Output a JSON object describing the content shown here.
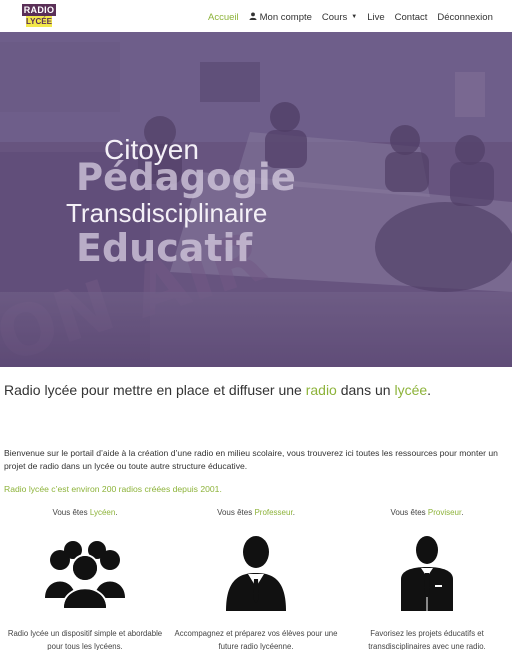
{
  "logo": {
    "line1": "RADIO",
    "line2": "LYCÉE"
  },
  "nav": {
    "items": [
      {
        "label": "Accueil",
        "active": true
      },
      {
        "label": "Mon compte",
        "icon": "user-icon"
      },
      {
        "label": "Cours",
        "icon": "caret-down-icon"
      },
      {
        "label": "Live"
      },
      {
        "label": "Contact"
      },
      {
        "label": "Déconnexion"
      }
    ]
  },
  "hero": {
    "words": [
      "Citoyen",
      "Pédagogie",
      "Transdisciplinaire",
      "Educatif"
    ]
  },
  "lead": {
    "before": "Radio lycée pour mettre en place et diffuser une ",
    "radio": "radio",
    "middle": " dans un ",
    "lycee": "lycée",
    "after": "."
  },
  "intro": "Bienvenue sur le portail d’aide à la création d’une radio en milieu scolaire, vous trouverez ici toutes les ressources pour monter un projet de radio dans un lycée ou toute autre structure éducative.",
  "stat": "Radio lycée c’est environ 200 radios créées depuis 2001.",
  "audiences": [
    {
      "prefix": "Vous êtes ",
      "role": "Lycéen",
      "suffix": ".",
      "icon": "students-group-icon",
      "desc": "Radio lycée un dispositif simple et abordable pour tous les lycéens."
    },
    {
      "prefix": "Vous êtes ",
      "role": "Professeur",
      "suffix": ".",
      "icon": "teacher-icon",
      "desc": "Accompagnez et préparez vos élèves pour une future radio lycéenne."
    },
    {
      "prefix": "Vous êtes ",
      "role": "Proviseur",
      "suffix": ".",
      "icon": "principal-icon",
      "desc": "Favorisez les projets éducatifs et transdisciplinaires avec une radio."
    }
  ],
  "colors": {
    "accent": "#8db33a",
    "hero_tint": "#6a5580",
    "logo_purple": "#5a2f57",
    "logo_yellow": "#f2e84b"
  }
}
